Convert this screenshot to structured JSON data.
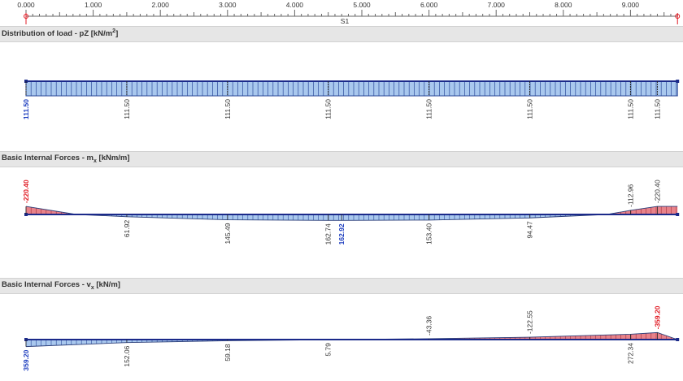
{
  "ruler": {
    "ticks": [
      "0.000",
      "1.000",
      "2.000",
      "3.000",
      "4.000",
      "5.000",
      "6.000",
      "7.000",
      "8.000",
      "9.000"
    ],
    "member_label": "S1"
  },
  "panels": [
    {
      "title_prefix": "Distribution of load - pZ [kN/m",
      "title_sup": "2",
      "title_suffix": "]",
      "labels": [
        {
          "x": 0.0,
          "value": "111.50",
          "emphasis": "min"
        },
        {
          "x": 1.5,
          "value": "111.50"
        },
        {
          "x": 3.0,
          "value": "111.50"
        },
        {
          "x": 4.5,
          "value": "111.50"
        },
        {
          "x": 6.0,
          "value": "111.50"
        },
        {
          "x": 7.5,
          "value": "111.50"
        },
        {
          "x": 9.0,
          "value": "111.50"
        },
        {
          "x": 9.4,
          "value": "111.50"
        }
      ]
    },
    {
      "title_prefix": "Basic Internal Forces - m",
      "title_sub": "x",
      "title_suffix": " [kNm/m]",
      "curve": [
        {
          "x": 0.0,
          "y": -220.4
        },
        {
          "x": 0.75,
          "y": 0
        },
        {
          "x": 1.5,
          "y": 61.92
        },
        {
          "x": 3.0,
          "y": 145.49
        },
        {
          "x": 4.5,
          "y": 162.74
        },
        {
          "x": 4.7,
          "y": 162.92
        },
        {
          "x": 6.0,
          "y": 153.4
        },
        {
          "x": 7.5,
          "y": 94.47
        },
        {
          "x": 8.65,
          "y": 0
        },
        {
          "x": 9.0,
          "y": -112.96
        },
        {
          "x": 9.4,
          "y": -220.4
        },
        {
          "x": 9.7,
          "y": -220.4
        }
      ],
      "labels": [
        {
          "x": 0.0,
          "value": "-220.40",
          "emphasis": "max"
        },
        {
          "x": 1.5,
          "value": "61.92"
        },
        {
          "x": 3.0,
          "value": "145.49"
        },
        {
          "x": 4.5,
          "value": "162.74"
        },
        {
          "x": 4.7,
          "value": "162.92",
          "emphasis": "min"
        },
        {
          "x": 6.0,
          "value": "153.40"
        },
        {
          "x": 7.5,
          "value": "94.47"
        },
        {
          "x": 9.0,
          "value": "-112.96"
        },
        {
          "x": 9.4,
          "value": "-220.40"
        }
      ]
    },
    {
      "title_prefix": "Basic Internal Forces - v",
      "title_sub": "x",
      "title_suffix": " [kN/m]",
      "curve": [
        {
          "x": 0.0,
          "y": 359.2
        },
        {
          "x": 1.5,
          "y": 152.06
        },
        {
          "x": 3.0,
          "y": 59.18
        },
        {
          "x": 4.5,
          "y": 5.79
        },
        {
          "x": 6.0,
          "y": -43.36
        },
        {
          "x": 7.5,
          "y": -122.55
        },
        {
          "x": 9.0,
          "y": -272.34
        },
        {
          "x": 9.4,
          "y": -359.2
        },
        {
          "x": 9.7,
          "y": 0
        }
      ],
      "labels": [
        {
          "x": 0.0,
          "value": "359.20",
          "emphasis": "min"
        },
        {
          "x": 1.5,
          "value": "152.06"
        },
        {
          "x": 3.0,
          "value": "59.18"
        },
        {
          "x": 4.5,
          "value": "5.79"
        },
        {
          "x": 6.0,
          "value": "-43.36"
        },
        {
          "x": 7.5,
          "value": "-122.55"
        },
        {
          "x": 9.0,
          "value": "272.34"
        },
        {
          "x": 9.4,
          "value": "-359.20",
          "emphasis": "max"
        }
      ]
    }
  ],
  "colors": {
    "positive_fill": "#a9c8ee",
    "negative_fill": "#e8828a",
    "member_line": "#1b2a8a",
    "max_text": "#e01b24",
    "min_text": "#1f3fbf",
    "label_text": "#333333"
  }
}
